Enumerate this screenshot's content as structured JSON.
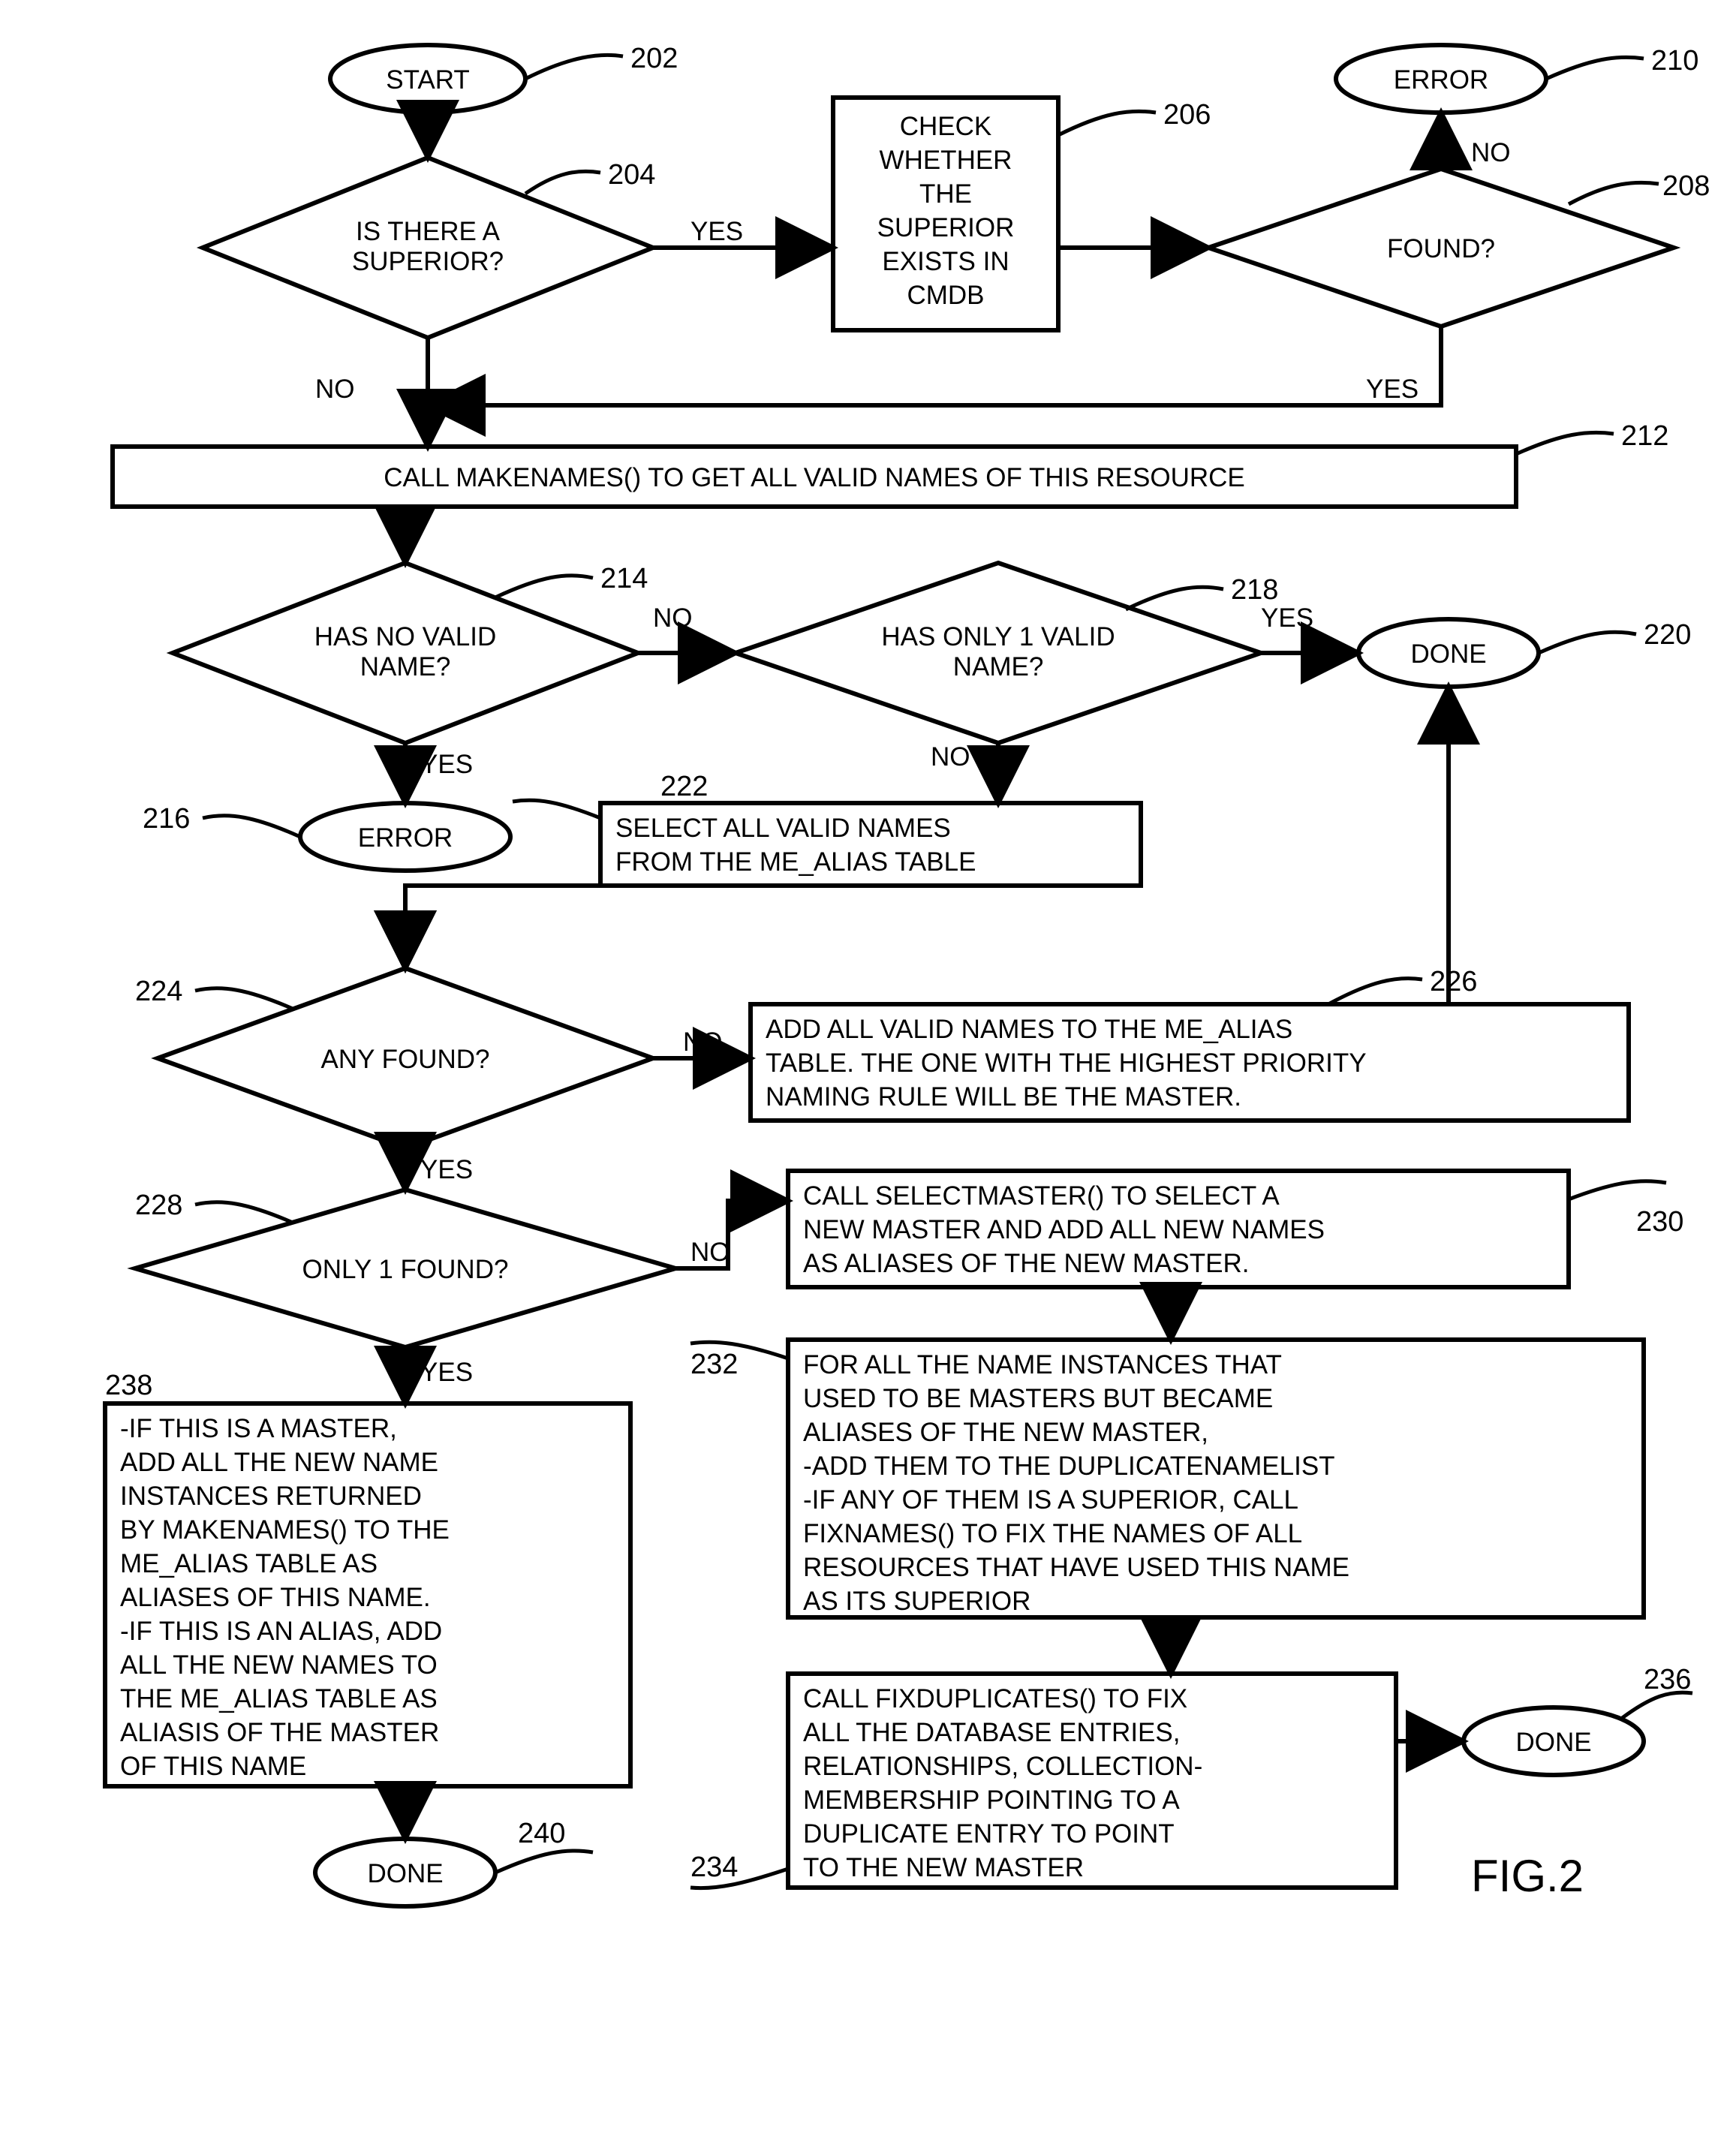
{
  "figure_label": "FIG.2",
  "nodes": {
    "n202": {
      "num": "202",
      "lines": [
        "START"
      ]
    },
    "n204": {
      "num": "204",
      "lines": [
        "IS THERE A",
        "SUPERIOR?"
      ]
    },
    "n206": {
      "num": "206",
      "lines": [
        "CHECK",
        "WHETHER",
        "THE",
        "SUPERIOR",
        "EXISTS IN",
        "CMDB"
      ]
    },
    "n208": {
      "num": "208",
      "lines": [
        "FOUND?"
      ]
    },
    "n210": {
      "num": "210",
      "lines": [
        "ERROR"
      ]
    },
    "n212": {
      "num": "212",
      "lines": [
        "CALL MAKENAMES() TO GET ALL VALID NAMES OF THIS RESOURCE"
      ]
    },
    "n214": {
      "num": "214",
      "lines": [
        "HAS NO VALID",
        "NAME?"
      ]
    },
    "n216": {
      "num": "216",
      "lines": [
        "ERROR"
      ]
    },
    "n218": {
      "num": "218",
      "lines": [
        "HAS ONLY 1 VALID",
        "NAME?"
      ]
    },
    "n220": {
      "num": "220",
      "lines": [
        "DONE"
      ]
    },
    "n222": {
      "num": "222",
      "lines": [
        "SELECT ALL VALID NAMES",
        "FROM THE ME_ALIAS TABLE"
      ]
    },
    "n224": {
      "num": "224",
      "lines": [
        "ANY FOUND?"
      ]
    },
    "n226": {
      "num": "226",
      "lines": [
        "ADD ALL VALID NAMES TO THE ME_ALIAS",
        "TABLE. THE ONE WITH THE HIGHEST PRIORITY",
        "NAMING RULE WILL BE THE MASTER."
      ]
    },
    "n228": {
      "num": "228",
      "lines": [
        "ONLY 1 FOUND?"
      ]
    },
    "n230": {
      "num": "230",
      "lines": [
        "CALL SELECTMASTER() TO SELECT A",
        "NEW MASTER AND ADD ALL NEW NAMES",
        "AS ALIASES OF THE NEW MASTER."
      ]
    },
    "n232": {
      "num": "232",
      "lines": [
        "FOR ALL THE NAME INSTANCES THAT",
        "USED TO BE MASTERS BUT BECAME",
        "ALIASES OF THE NEW MASTER,",
        "-ADD THEM TO THE DUPLICATENAMELIST",
        "-IF ANY OF THEM IS A SUPERIOR, CALL",
        "FIXNAMES() TO FIX THE NAMES OF ALL",
        "RESOURCES THAT HAVE USED THIS NAME",
        "AS ITS SUPERIOR"
      ]
    },
    "n234": {
      "num": "234",
      "lines": [
        "CALL FIXDUPLICATES() TO FIX",
        "ALL THE DATABASE ENTRIES,",
        "RELATIONSHIPS, COLLECTION-",
        "MEMBERSHIP POINTING TO A",
        "DUPLICATE ENTRY TO POINT",
        "TO THE NEW MASTER"
      ]
    },
    "n236": {
      "num": "236",
      "lines": [
        "DONE"
      ]
    },
    "n238": {
      "num": "238",
      "lines": [
        "-IF THIS IS A MASTER,",
        "ADD ALL THE NEW NAME",
        "INSTANCES RETURNED",
        "BY MAKENAMES() TO THE",
        "ME_ALIAS TABLE AS",
        "ALIASES OF THIS NAME.",
        "-IF THIS IS AN ALIAS, ADD",
        "ALL THE NEW NAMES TO",
        "THE ME_ALIAS TABLE AS",
        "ALIASIS OF THE MASTER",
        "OF THIS NAME"
      ]
    },
    "n240": {
      "num": "240",
      "lines": [
        "DONE"
      ]
    }
  },
  "edges": {
    "e204_yes": "YES",
    "e204_no": "NO",
    "e208_yes": "YES",
    "e208_no": "NO",
    "e214_yes": "YES",
    "e214_no": "NO",
    "e218_yes": "YES",
    "e218_no": "NO",
    "e224_yes": "YES",
    "e224_no": "NO",
    "e228_yes": "YES",
    "e228_no": "NO"
  },
  "chart_data": {
    "type": "flowchart",
    "title": "FIG.2",
    "nodes": [
      {
        "id": "202",
        "shape": "terminator",
        "text": "START"
      },
      {
        "id": "204",
        "shape": "decision",
        "text": "IS THERE A SUPERIOR?"
      },
      {
        "id": "206",
        "shape": "process",
        "text": "CHECK WHETHER THE SUPERIOR EXISTS IN CMDB"
      },
      {
        "id": "208",
        "shape": "decision",
        "text": "FOUND?"
      },
      {
        "id": "210",
        "shape": "terminator",
        "text": "ERROR"
      },
      {
        "id": "212",
        "shape": "process",
        "text": "CALL MAKENAMES() TO GET ALL VALID NAMES OF THIS RESOURCE"
      },
      {
        "id": "214",
        "shape": "decision",
        "text": "HAS NO VALID NAME?"
      },
      {
        "id": "216",
        "shape": "terminator",
        "text": "ERROR"
      },
      {
        "id": "218",
        "shape": "decision",
        "text": "HAS ONLY 1 VALID NAME?"
      },
      {
        "id": "220",
        "shape": "terminator",
        "text": "DONE"
      },
      {
        "id": "222",
        "shape": "process",
        "text": "SELECT ALL VALID NAMES FROM THE ME_ALIAS TABLE"
      },
      {
        "id": "224",
        "shape": "decision",
        "text": "ANY FOUND?"
      },
      {
        "id": "226",
        "shape": "process",
        "text": "ADD ALL VALID NAMES TO THE ME_ALIAS TABLE. THE ONE WITH THE HIGHEST PRIORITY NAMING RULE WILL BE THE MASTER."
      },
      {
        "id": "228",
        "shape": "decision",
        "text": "ONLY 1 FOUND?"
      },
      {
        "id": "230",
        "shape": "process",
        "text": "CALL SELECTMASTER() TO SELECT A NEW MASTER AND ADD ALL NEW NAMES AS ALIASES OF THE NEW MASTER."
      },
      {
        "id": "232",
        "shape": "process",
        "text": "FOR ALL THE NAME INSTANCES THAT USED TO BE MASTERS BUT BECAME ALIASES OF THE NEW MASTER, -ADD THEM TO THE DUPLICATENAMELIST -IF ANY OF THEM IS A SUPERIOR, CALL FIXNAMES() TO FIX THE NAMES OF ALL RESOURCES THAT HAVE USED THIS NAME AS ITS SUPERIOR"
      },
      {
        "id": "234",
        "shape": "process",
        "text": "CALL FIXDUPLICATES() TO FIX ALL THE DATABASE ENTRIES, RELATIONSHIPS, COLLECTION-MEMBERSHIP POINTING TO A DUPLICATE ENTRY TO POINT TO THE NEW MASTER"
      },
      {
        "id": "236",
        "shape": "terminator",
        "text": "DONE"
      },
      {
        "id": "238",
        "shape": "process",
        "text": "-IF THIS IS A MASTER, ADD ALL THE NEW NAME INSTANCES RETURNED BY MAKENAMES() TO THE ME_ALIAS TABLE AS ALIASES OF THIS NAME. -IF THIS IS AN ALIAS, ADD ALL THE NEW NAMES TO THE ME_ALIAS TABLE AS ALIASIS OF THE MASTER OF THIS NAME"
      },
      {
        "id": "240",
        "shape": "terminator",
        "text": "DONE"
      }
    ],
    "edges": [
      {
        "from": "202",
        "to": "204"
      },
      {
        "from": "204",
        "to": "206",
        "label": "YES"
      },
      {
        "from": "204",
        "to": "212",
        "label": "NO"
      },
      {
        "from": "206",
        "to": "208"
      },
      {
        "from": "208",
        "to": "210",
        "label": "NO"
      },
      {
        "from": "208",
        "to": "212",
        "label": "YES"
      },
      {
        "from": "212",
        "to": "214"
      },
      {
        "from": "214",
        "to": "216",
        "label": "YES"
      },
      {
        "from": "214",
        "to": "218",
        "label": "NO"
      },
      {
        "from": "218",
        "to": "220",
        "label": "YES"
      },
      {
        "from": "218",
        "to": "222",
        "label": "NO"
      },
      {
        "from": "222",
        "to": "224"
      },
      {
        "from": "224",
        "to": "226",
        "label": "NO"
      },
      {
        "from": "224",
        "to": "228",
        "label": "YES"
      },
      {
        "from": "226",
        "to": "220"
      },
      {
        "from": "228",
        "to": "230",
        "label": "NO"
      },
      {
        "from": "228",
        "to": "238",
        "label": "YES"
      },
      {
        "from": "230",
        "to": "232"
      },
      {
        "from": "232",
        "to": "234"
      },
      {
        "from": "234",
        "to": "236"
      },
      {
        "from": "238",
        "to": "240"
      }
    ]
  }
}
